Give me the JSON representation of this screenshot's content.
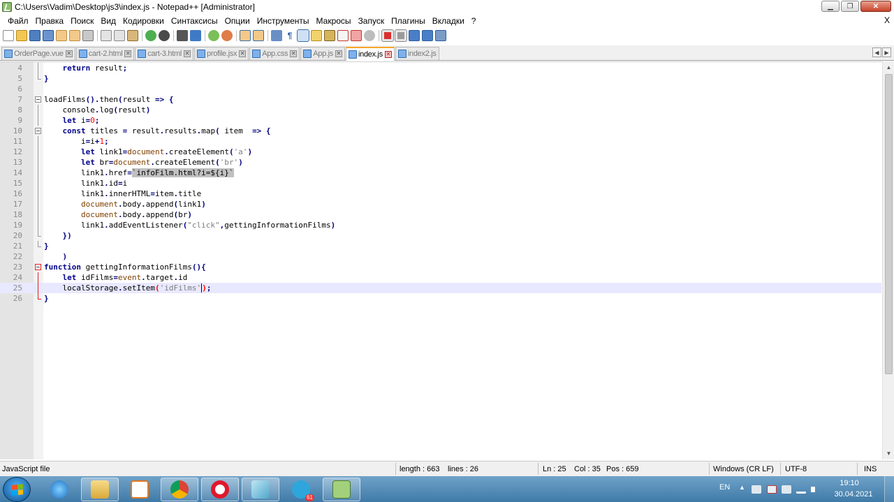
{
  "window": {
    "title": "C:\\Users\\Vadim\\Desktop\\js3\\index.js - Notepad++ [Administrator]",
    "buttons": [
      "minimize",
      "maximize",
      "close"
    ]
  },
  "menu": {
    "items": [
      "Файл",
      "Правка",
      "Поиск",
      "Вид",
      "Кодировки",
      "Синтаксисы",
      "Опции",
      "Инструменты",
      "Макросы",
      "Запуск",
      "Плагины",
      "Вкладки",
      "?"
    ],
    "close_label": "X"
  },
  "toolbar": {
    "icons": [
      "new-file-icon",
      "open-file-icon",
      "save-icon",
      "save-all-icon",
      "close-icon",
      "close-all-icon",
      "print-icon",
      "cut-icon",
      "copy-icon",
      "paste-icon",
      "undo-icon",
      "redo-icon",
      "find-icon",
      "replace-icon",
      "zoom-in-icon",
      "zoom-out-icon",
      "sync-vertical-icon",
      "sync-horizontal-icon",
      "word-wrap-icon",
      "show-all-chars-icon",
      "indent-guide-icon",
      "user-lang-icon",
      "doc-map-icon",
      "function-list-icon",
      "folder-workspace-icon",
      "monitoring-icon",
      "record-macro-icon",
      "stop-macro-icon",
      "play-macro-icon",
      "run-macro-multiple-icon",
      "save-macro-icon"
    ]
  },
  "tabs": [
    {
      "label": "OrderPage.vue",
      "active": false
    },
    {
      "label": "cart-2.html",
      "active": false
    },
    {
      "label": "cart-3.html",
      "active": false
    },
    {
      "label": "profile.jsx",
      "active": false
    },
    {
      "label": "App.css",
      "active": false
    },
    {
      "label": "App.js",
      "active": false
    },
    {
      "label": "index.js",
      "active": true
    },
    {
      "label": "index2.js",
      "active": false
    }
  ],
  "editor": {
    "lines": [
      {
        "n": "4"
      },
      {
        "n": "5"
      },
      {
        "n": "6"
      },
      {
        "n": "7"
      },
      {
        "n": "8"
      },
      {
        "n": "9"
      },
      {
        "n": "10"
      },
      {
        "n": "11"
      },
      {
        "n": "12"
      },
      {
        "n": "13"
      },
      {
        "n": "14"
      },
      {
        "n": "15"
      },
      {
        "n": "16"
      },
      {
        "n": "17"
      },
      {
        "n": "18"
      },
      {
        "n": "19"
      },
      {
        "n": "20"
      },
      {
        "n": "21"
      },
      {
        "n": "22"
      },
      {
        "n": "23"
      },
      {
        "n": "24"
      },
      {
        "n": "25"
      },
      {
        "n": "26"
      }
    ],
    "current_line": "25"
  },
  "status": {
    "file_type": "JavaScript file",
    "length": "length : 663",
    "lines": "lines : 26",
    "ln": "Ln : 25",
    "col": "Col : 35",
    "pos": "Pos : 659",
    "eol": "Windows (CR LF)",
    "encoding": "UTF-8",
    "mode": "INS"
  },
  "taskbar": {
    "apps": [
      "internet-explorer-icon",
      "file-explorer-icon",
      "media-player-icon",
      "chrome-icon",
      "opera-icon",
      "notes-icon",
      "telegram-icon",
      "notepad-plus-plus-icon"
    ],
    "telegram_badge": "61",
    "language": "EN",
    "time": "19:10",
    "date": "30.04.2021"
  }
}
